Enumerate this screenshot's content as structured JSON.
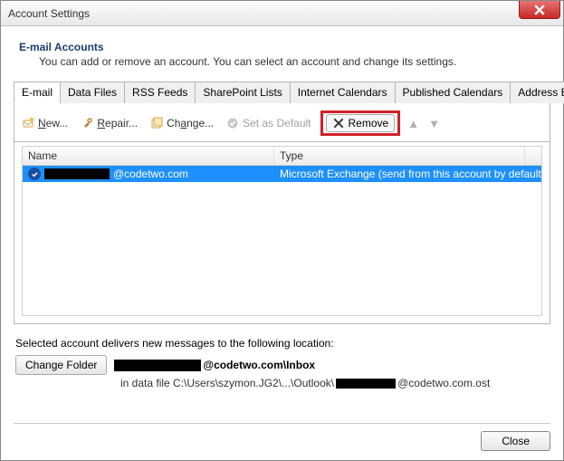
{
  "window": {
    "title": "Account Settings"
  },
  "header": {
    "heading": "E-mail Accounts",
    "subtext": "You can add or remove an account. You can select an account and change its settings."
  },
  "tabs": {
    "items": [
      "E-mail",
      "Data Files",
      "RSS Feeds",
      "SharePoint Lists",
      "Internet Calendars",
      "Published Calendars",
      "Address Books"
    ],
    "active": 0
  },
  "toolbar": {
    "new": "New...",
    "repair": "Repair...",
    "change": "Change...",
    "setdefault": "Set as Default",
    "remove": "Remove"
  },
  "grid": {
    "col_name": "Name",
    "col_type": "Type",
    "rows": [
      {
        "name_suffix": "@codetwo.com",
        "type": "Microsoft Exchange (send from this account by default)"
      }
    ]
  },
  "delivery": {
    "label": "Selected account delivers new messages to the following location:",
    "change_folder": "Change Folder",
    "loc_suffix": "@codetwo.com\\Inbox",
    "datafile_prefix": "in data file C:\\Users\\szymon.JG2\\...\\Outlook\\",
    "datafile_suffix": "@codetwo.com.ost"
  },
  "footer": {
    "close": "Close"
  }
}
